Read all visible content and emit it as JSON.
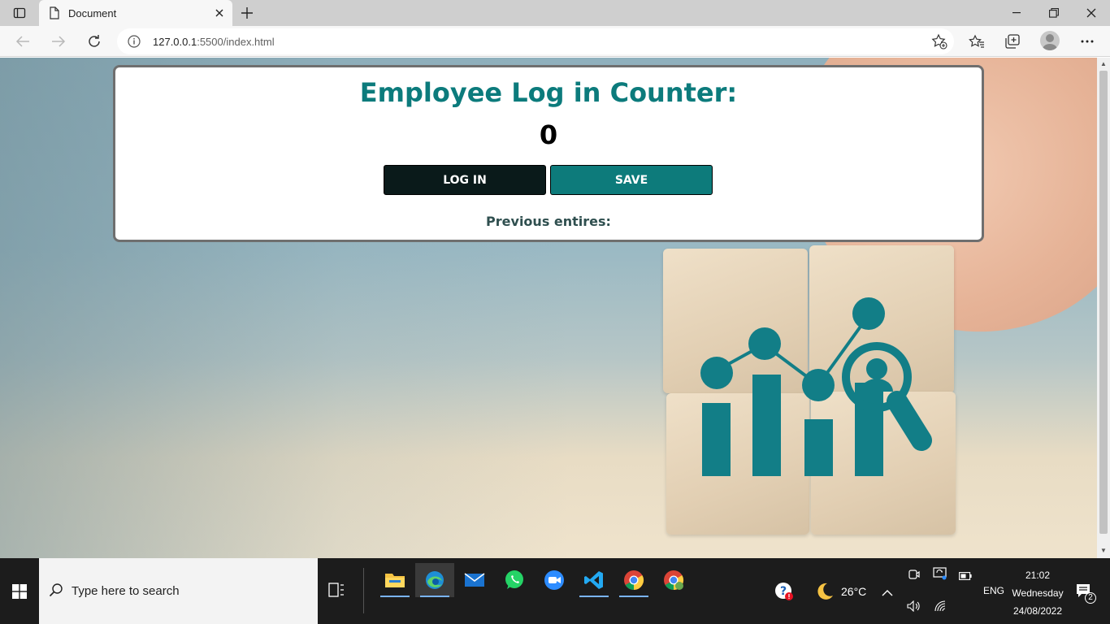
{
  "browser": {
    "tab_title": "Document",
    "url_host": "127.0.0.1",
    "url_rest": ":5500/index.html"
  },
  "page": {
    "title": "Employee Log in Counter:",
    "counter_value": "0",
    "login_label": "LOG IN",
    "save_label": "SAVE",
    "previous_label": "Previous entires:"
  },
  "colors": {
    "accent": "#0c7b7c",
    "login_button": "#0a1a1a",
    "save_button": "#0d7b7b"
  },
  "taskbar": {
    "search_placeholder": "Type here to search",
    "apps": [
      "file-explorer",
      "edge",
      "mail",
      "whatsapp",
      "zoom",
      "vscode",
      "chrome",
      "chrome-profile"
    ],
    "weather_temp": "26°C",
    "language": "ENG",
    "time": "21:02",
    "day": "Wednesday",
    "date": "24/08/2022",
    "notification_count": "2"
  }
}
